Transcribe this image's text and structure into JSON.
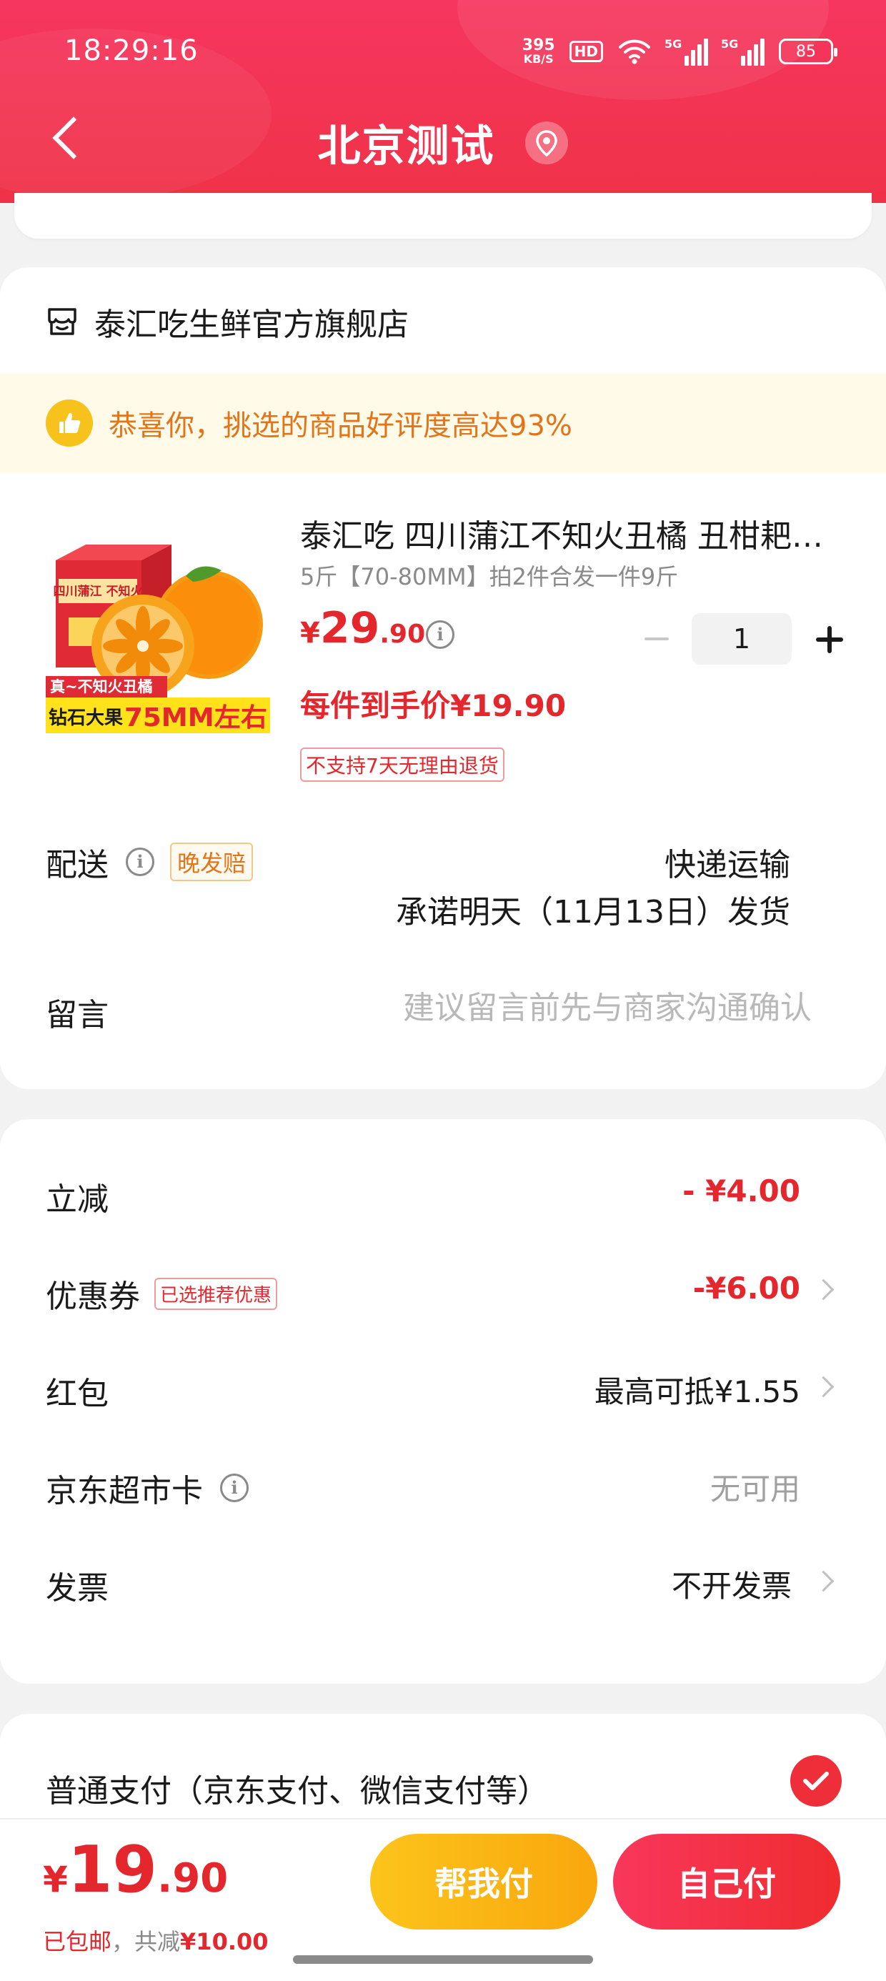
{
  "status_bar": {
    "time": "18:29:16",
    "net_speed_value": "395",
    "net_speed_unit": "KB/S",
    "hd_label": "HD",
    "signal1_label": "5G",
    "signal2_label": "5G",
    "battery_level": "85",
    "icons": [
      "hd-icon",
      "wifi-icon",
      "signal-5g-icon",
      "signal-5g-icon",
      "battery-icon"
    ]
  },
  "header": {
    "title": "北京测试",
    "back_icon": "chevron-left-icon",
    "location_icon": "location-pin-icon",
    "background_color": "#f03248"
  },
  "store": {
    "name": "泰汇吃生鲜官方旗舰店",
    "icon": "store-icon"
  },
  "praise": {
    "text": "恭喜你，挑选的商品好评度高达93%",
    "icon": "thumbs-up-icon"
  },
  "product": {
    "title": "泰汇吃 四川蒲江不知火丑橘 丑柑耙耙柑",
    "spec": "5斤【70-80MM】拍2件合发一件9斤",
    "image_caption_top": "真~不知火丑橘",
    "image_caption_left": "钻石大果",
    "image_caption_right": "75MM左右",
    "image_box_text": "四川蒲江 不知火",
    "price_currency": "¥",
    "price_integer": "29",
    "price_decimal": ".90",
    "quantity": "1",
    "final_price_text": "每件到手价¥19.90",
    "return_policy": "不支持7天无理由退货"
  },
  "shipping": {
    "label": "配送",
    "tag": "晚发赔",
    "method": "快递运输",
    "date": "承诺明天（11月13日）发货"
  },
  "note": {
    "label": "留言",
    "placeholder": "建议留言前先与商家沟通确认",
    "value": ""
  },
  "discounts": {
    "instant": {
      "label": "立减",
      "value": "- ¥4.00"
    },
    "coupon": {
      "label": "优惠券",
      "tag": "已选推荐优惠",
      "value": "-¥6.00"
    },
    "red_packet": {
      "label": "红包",
      "value": "最高可抵¥1.55"
    },
    "market_card": {
      "label": "京东超市卡",
      "value": "无可用"
    },
    "invoice": {
      "label": "发票",
      "value": "不开发票"
    }
  },
  "payment": {
    "label": "普通支付（京东支付、微信支付等）",
    "selected": true
  },
  "footer": {
    "currency": "¥",
    "total_integer": "19",
    "total_decimal": ".90",
    "shipping_text": "已包邮",
    "saved_prefix": "，共减",
    "saved_amount": "¥10.00",
    "help_pay_label": "帮我付",
    "self_pay_label": "自己付",
    "accent_color": "#e4262d"
  }
}
